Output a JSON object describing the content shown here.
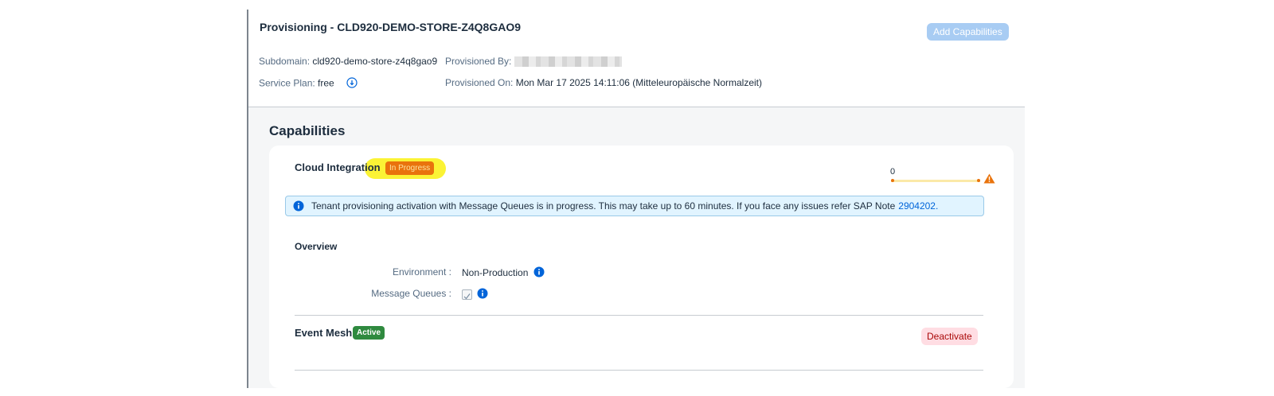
{
  "header": {
    "title": "Provisioning - CLD920-DEMO-STORE-Z4Q8GAO9",
    "add_capabilities": "Add Capabilities",
    "subdomain_label": "Subdomain:",
    "subdomain_value": "cld920-demo-store-z4q8gao9",
    "service_plan_label": "Service Plan:",
    "service_plan_value": "free",
    "provisioned_by_label": "Provisioned By:",
    "provisioned_on_label": "Provisioned On:",
    "provisioned_on_value": "Mon Mar 17 2025 14:11:06 (Mitteleuropäische Normalzeit)"
  },
  "capabilities": {
    "heading": "Capabilities",
    "cloud_integration": {
      "name": "Cloud Integration",
      "status": "In Progress",
      "progress_value": "0",
      "progress_fraction": 0,
      "message": "Tenant provisioning activation with Message Queues is in progress. This may take up to 60 minutes. If you face any issues refer SAP Note",
      "note_link": "2904202",
      "note_suffix": ".",
      "overview_heading": "Overview",
      "environment_label": "Environment :",
      "environment_value": "Non-Production",
      "message_queues_label": "Message Queues :",
      "message_queues_checked": true
    },
    "event_mesh": {
      "name": "Event Mesh",
      "status": "Active",
      "deactivate": "Deactivate"
    }
  },
  "colors": {
    "in_progress": "#e9730c",
    "active": "#2f8a3f",
    "info": "#0064d9",
    "highlight": "#fbf335"
  },
  "icons": [
    "info-icon",
    "warning-icon",
    "checkbox-check-icon"
  ]
}
